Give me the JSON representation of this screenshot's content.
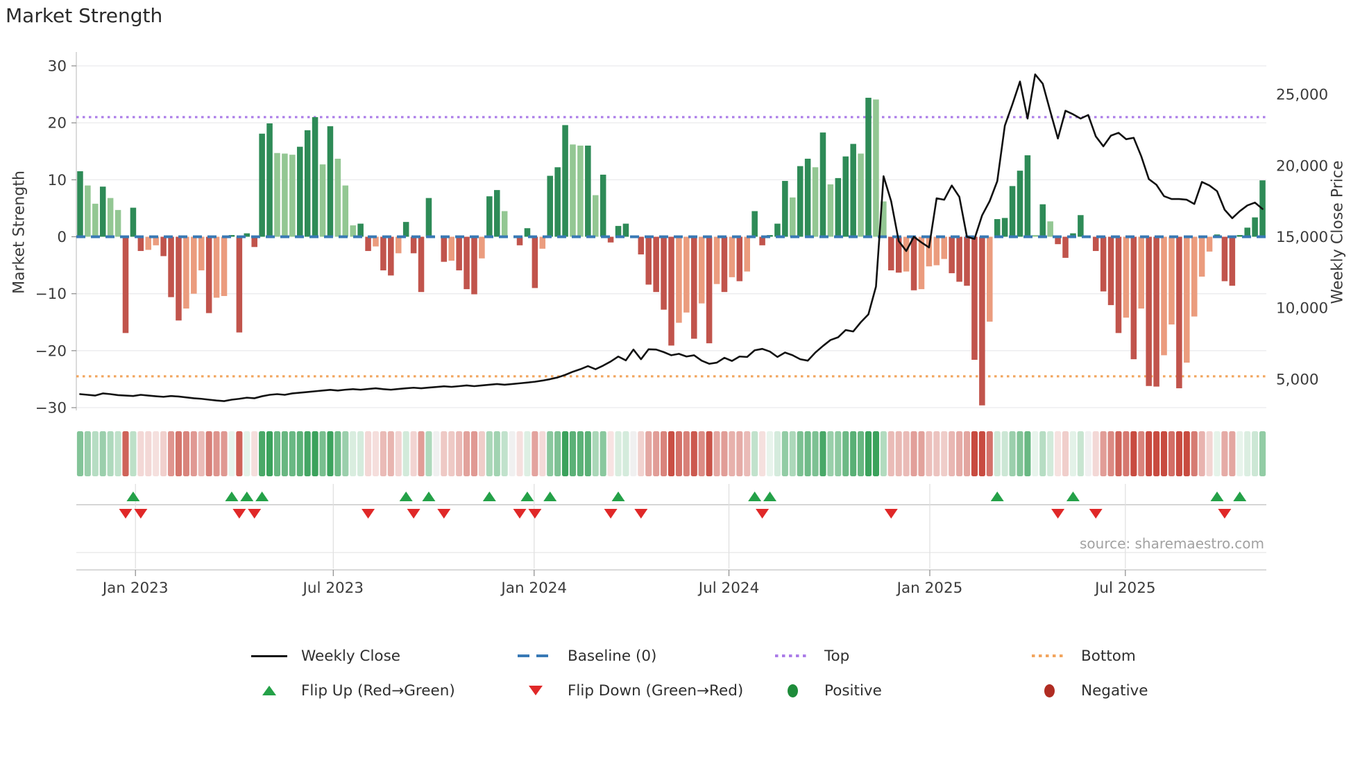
{
  "title": "Market Strength",
  "source": "source: sharemaestro.com",
  "axes": {
    "left_label": "Market Strength",
    "right_label": "Weekly Close Price",
    "left_ticks": [
      {
        "label": "30",
        "value": 30
      },
      {
        "label": "20",
        "value": 20
      },
      {
        "label": "10",
        "value": 10
      },
      {
        "label": "0",
        "value": 0
      },
      {
        "label": "−10",
        "value": -10
      },
      {
        "label": "−20",
        "value": -20
      },
      {
        "label": "−30",
        "value": -30
      }
    ],
    "right_ticks": [
      {
        "label": "25,000",
        "value": 25000
      },
      {
        "label": "20,000",
        "value": 20000
      },
      {
        "label": "15,000",
        "value": 15000
      },
      {
        "label": "10,000",
        "value": 10000
      },
      {
        "label": "5,000",
        "value": 5000
      }
    ],
    "x_ticks": [
      {
        "label": "Jan 2023",
        "week": 7.3
      },
      {
        "label": "Jul 2023",
        "week": 33.4
      },
      {
        "label": "Jan 2024",
        "week": 59.9
      },
      {
        "label": "Jul 2024",
        "week": 85.6
      },
      {
        "label": "Jan 2025",
        "week": 112.1
      },
      {
        "label": "Jul 2025",
        "week": 137.9
      }
    ]
  },
  "chart_data": {
    "type": "combo_bar_line_weekly",
    "x_unit": "week",
    "left_axis_range": [
      -32.4,
      32.4
    ],
    "grid_strength_levels": [
      30,
      20,
      10,
      -10,
      -20,
      -30
    ],
    "baseline": 0,
    "top_level": 21,
    "bottom_level": -24.5,
    "right_axis": {
      "center": 15000,
      "units_per_strength": 400
    },
    "series": [
      {
        "name": "Market Strength",
        "type": "bar",
        "values": [
          11.5,
          9,
          5.8,
          8.8,
          6.8,
          4.7,
          -16.9,
          5.1,
          -2.5,
          -2.3,
          -1.5,
          -3.4,
          -10.6,
          -14.7,
          -12.6,
          -10,
          -5.9,
          -13.4,
          -10.7,
          -10.4,
          0.3,
          -16.8,
          0.6,
          -1.8,
          18.1,
          19.9,
          14.7,
          14.6,
          14.4,
          15.8,
          18.7,
          21,
          12.7,
          19.4,
          13.7,
          9,
          2,
          2.3,
          -2.5,
          -1.7,
          -5.9,
          -6.8,
          -2.9,
          2.6,
          -2.9,
          -9.7,
          6.8,
          0,
          -4.4,
          -4.2,
          -5.9,
          -9.2,
          -10.1,
          -3.8,
          7.1,
          8.2,
          4.5,
          0,
          -1.5,
          1.5,
          -9,
          -2.1,
          10.7,
          12.2,
          19.6,
          16.2,
          16,
          16,
          7.3,
          10.9,
          -1,
          1.9,
          2.3,
          0,
          -3.1,
          -8.4,
          -9.7,
          -12.8,
          -19.1,
          -15.1,
          -13.3,
          -17.9,
          -11.7,
          -18.7,
          -8.3,
          -9.7,
          -7.1,
          -7.8,
          -6.1,
          4.5,
          -1.5,
          0.3,
          2.3,
          9.8,
          6.9,
          12.4,
          13.7,
          12.2,
          18.3,
          9.2,
          10.3,
          14.1,
          16.3,
          14.6,
          24.4,
          24.1,
          6.2,
          -5.9,
          -6.3,
          -6.1,
          -9.4,
          -9.2,
          -5.2,
          -5,
          -3.9,
          -6.4,
          -7.9,
          -8.6,
          -21.6,
          -29.6,
          -14.9,
          3.1,
          3.3,
          8.9,
          11.6,
          14.3,
          0.3,
          5.7,
          2.7,
          -1.3,
          -3.7,
          0.6,
          3.8,
          0,
          -2.5,
          -9.6,
          -12,
          -16.9,
          -14.2,
          -21.5,
          -12.6,
          -26.2,
          -26.3,
          -20.8,
          -15.4,
          -26.6,
          -22.1,
          -14,
          -7,
          -2.6,
          0.4,
          -7.8,
          -8.6,
          0.3,
          1.6,
          3.4,
          9.9
        ]
      },
      {
        "name": "Weekly Close",
        "type": "line",
        "axis": "right",
        "values": [
          3950,
          3900,
          3850,
          4000,
          3950,
          3880,
          3850,
          3820,
          3900,
          3850,
          3800,
          3760,
          3820,
          3780,
          3720,
          3660,
          3620,
          3560,
          3500,
          3460,
          3560,
          3620,
          3700,
          3660,
          3800,
          3900,
          3950,
          3900,
          4000,
          4050,
          4100,
          4150,
          4200,
          4250,
          4200,
          4260,
          4300,
          4260,
          4310,
          4360,
          4300,
          4260,
          4310,
          4360,
          4400,
          4360,
          4410,
          4450,
          4500,
          4460,
          4510,
          4560,
          4510,
          4560,
          4610,
          4660,
          4610,
          4660,
          4710,
          4760,
          4820,
          4900,
          5000,
          5120,
          5300,
          5520,
          5700,
          5920,
          5700,
          5950,
          6240,
          6590,
          6320,
          7080,
          6400,
          7100,
          7080,
          6900,
          6680,
          6780,
          6590,
          6680,
          6300,
          6080,
          6160,
          6500,
          6280,
          6590,
          6560,
          7030,
          7130,
          6940,
          6560,
          6870,
          6680,
          6400,
          6300,
          6870,
          7330,
          7750,
          7940,
          8450,
          8350,
          9000,
          9550,
          11500,
          19250,
          17500,
          14700,
          14000,
          15000,
          14600,
          14250,
          17700,
          17600,
          18600,
          17800,
          15000,
          14850,
          16500,
          17500,
          18900,
          22800,
          24300,
          25900,
          23300,
          26400,
          25750,
          23800,
          21900,
          23850,
          23600,
          23300,
          23550,
          22050,
          21350,
          22100,
          22300,
          21850,
          21950,
          20650,
          19050,
          18650,
          17850,
          17650,
          17650,
          17600,
          17300,
          18850,
          18600,
          18200,
          16900,
          16300,
          16800,
          17200,
          17400,
          16950
        ]
      }
    ],
    "flip_rule": "marker at every sign change of Market Strength bars",
    "heatmap_strip": "color intensity proportional to |Market Strength| (green positive, red negative)"
  },
  "legend": {
    "rows": [
      [
        {
          "label": "Weekly Close",
          "marker": "black-line"
        },
        {
          "label": "Baseline (0)",
          "marker": "blue-dashes"
        },
        {
          "label": "Top",
          "marker": "purple-dots"
        },
        {
          "label": "Bottom",
          "marker": "orange-dots"
        }
      ],
      [
        {
          "label": "Flip Up (Red→Green)",
          "marker": "green-up-triangle"
        },
        {
          "label": "Flip Down (Green→Red)",
          "marker": "red-down-triangle"
        },
        {
          "label": "Positive",
          "marker": "green-dot"
        },
        {
          "label": "Negative",
          "marker": "dark-red-dot"
        }
      ]
    ]
  },
  "colors": {
    "bar_pos_dark": "#2e8b57",
    "bar_pos_light": "#93c793",
    "bar_neg_dark": "#c1544c",
    "bar_neg_light": "#eb9c7e",
    "baseline": "#3879b5",
    "top": "#ab7ce8",
    "bottom": "#f2a55e",
    "price_line": "#111111",
    "flip_up": "#24a148",
    "flip_down": "#e02828",
    "positive_dot": "#1e8c3a",
    "negative_dot": "#b02c22",
    "heat_pos_rgb": "42,154,78",
    "heat_neg_rgb": "195,60,48",
    "grid": "#ebebee",
    "spine": "#cfcfcf",
    "tick_text": "#3b3b3b",
    "source_text": "#a2a2a2"
  }
}
